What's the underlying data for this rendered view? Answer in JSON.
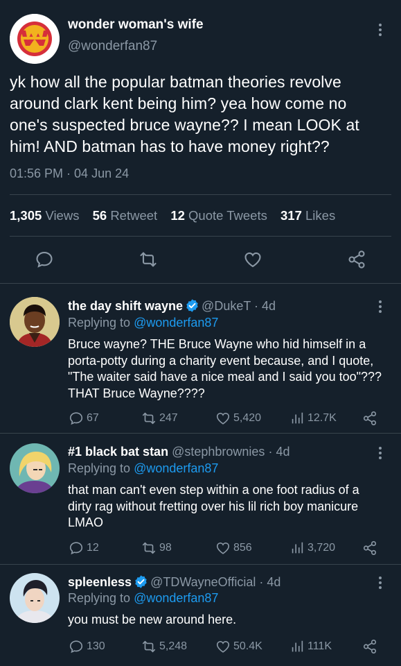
{
  "main_tweet": {
    "display_name": "wonder woman's wife",
    "handle": "@wonderfan87",
    "text": "yk how all the popular batman theories revolve around clark kent being him? yea how come no one's suspected bruce wayne?? I mean LOOK at him! AND batman has to have money right??",
    "timestamp": "01:56 PM · 04 Jun 24",
    "stats": {
      "views_count": "1,305",
      "views_label": "Views",
      "retweets_count": "56",
      "retweets_label": "Retweet",
      "quotes_count": "12",
      "quotes_label": "Quote Tweets",
      "likes_count": "317",
      "likes_label": "Likes"
    },
    "actions": [
      "reply-icon",
      "retweet-icon",
      "like-icon",
      "share-icon"
    ]
  },
  "replies": [
    {
      "display_name": "the day shift wayne",
      "verified": true,
      "handle": "@DukeT",
      "age": "· 4d",
      "replying_prefix": "Replying to",
      "replying_to": "@wonderfan87",
      "text": "Bruce wayne? THE Bruce Wayne who hid himself in a porta-potty during a charity event because, and I quote, \"The waiter said have a nice meal and I said you too\"??? THAT Bruce Wayne????",
      "replies": "67",
      "retweets": "247",
      "likes": "5,420",
      "views": "12.7K"
    },
    {
      "display_name": "#1 black bat stan",
      "verified": false,
      "handle": "@stephbrownies",
      "age": "· 4d",
      "replying_prefix": "Replying to",
      "replying_to": "@wonderfan87",
      "text": "that man can't even step within a one foot radius of a dirty rag without fretting over his lil rich boy manicure LMAO",
      "replies": "12",
      "retweets": "98",
      "likes": "856",
      "views": "3,720"
    },
    {
      "display_name": "spleenless",
      "verified": true,
      "handle": "@TDWayneOfficial",
      "age": "· 4d",
      "replying_prefix": "Replying to",
      "replying_to": "@wonderfan87",
      "text": "you must be new around here.",
      "replies": "130",
      "retweets": "5,248",
      "likes": "50.4K",
      "views": "111K"
    }
  ],
  "colors": {
    "background": "#15202b",
    "text": "#ffffff",
    "muted": "#8b98a5",
    "link": "#1d9bf0",
    "divider": "#38444d",
    "verified": "#1d9bf0"
  }
}
